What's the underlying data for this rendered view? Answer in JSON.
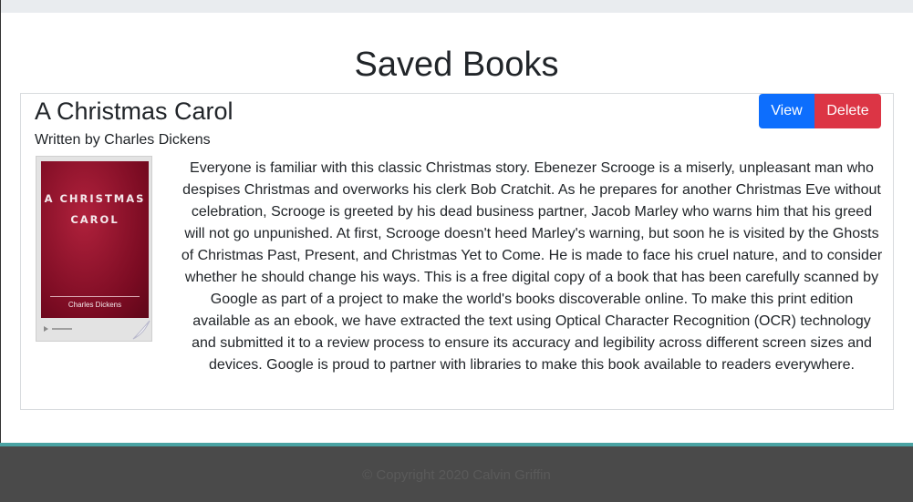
{
  "header": {
    "title": "Saved Books"
  },
  "book": {
    "title": "A Christmas Carol",
    "author_line": "Written by Charles Dickens",
    "view_label": "View",
    "delete_label": "Delete",
    "cover": {
      "title": "A CHRISTMAS\nCAROL",
      "author": "Charles Dickens",
      "color": "#8b1028"
    },
    "description": "Everyone is familiar with this classic Christmas story. Ebenezer Scrooge is a miserly, unpleasant man who despises Christmas and overworks his clerk Bob Cratchit. As he prepares for another Christmas Eve without celebration, Scrooge is greeted by his dead business partner, Jacob Marley who warns him that his greed will not go unpunished. At first, Scrooge doesn't heed Marley's warning, but soon he is visited by the Ghosts of Christmas Past, Present, and Christmas Yet to Come. He is made to face his cruel nature, and to consider whether he should change his ways. This is a free digital copy of a book that has been carefully scanned by Google as part of a project to make the world's books discoverable online. To make this print edition available as an ebook, we have extracted the text using Optical Character Recognition (OCR) technology and submitted it to a review process to ensure its accuracy and legibility across different screen sizes and devices. Google is proud to partner with libraries to make this book available to readers everywhere."
  },
  "footer": {
    "copyright": "© Copyright 2020 Calvin Griffin"
  },
  "colors": {
    "view_button": "#0d6efd",
    "delete_button": "#dc3545",
    "footer_background": "#4a4a4a",
    "footer_accent": "#4aa3a3"
  }
}
